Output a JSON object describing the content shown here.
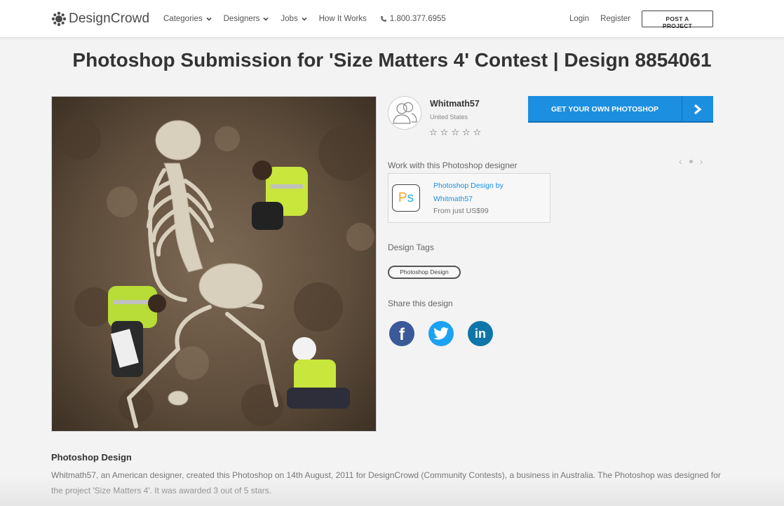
{
  "colors": {
    "accent": "#1c8fe0",
    "facebook": "#3b5998",
    "twitter": "#1da1f2",
    "linkedin": "#0e76a8"
  },
  "header": {
    "logo_text": "DesignCrowd",
    "nav": [
      {
        "label": "Categories",
        "has_dropdown": true
      },
      {
        "label": "Designers",
        "has_dropdown": true
      },
      {
        "label": "Jobs",
        "has_dropdown": true
      },
      {
        "label": "How It Works",
        "has_dropdown": false
      }
    ],
    "phone": "1.800.377.6955",
    "login": "Login",
    "register": "Register",
    "post_project": "POST A PROJECT"
  },
  "page_title": "Photoshop Submission for 'Size Matters 4' Contest | Design 8854061",
  "designer": {
    "name": "Whitmath57",
    "country": "United States",
    "rating_stars": 5,
    "star_glyph": "☆"
  },
  "cta_label": "GET YOUR OWN PHOTOSHOP",
  "work": {
    "label": "Work with this Photoshop designer",
    "card_title": "Photoshop Design by Whitmath57",
    "card_price": "From just US$99",
    "icon_p": "P",
    "icon_s": "s"
  },
  "tags": {
    "label": "Design Tags",
    "items": [
      "Photoshop Design"
    ]
  },
  "share": {
    "label": "Share this design",
    "facebook_glyph": "f",
    "linkedin_glyph": "in"
  },
  "description": {
    "title": "Photoshop Design",
    "text": "Whitmath57, an American designer, created this Photoshop on 14th August, 2011 for DesignCrowd (Community Contests), a business in Australia. The Photoshop was designed for the project 'Size Matters 4'. It was awarded 3 out of 5 stars."
  }
}
